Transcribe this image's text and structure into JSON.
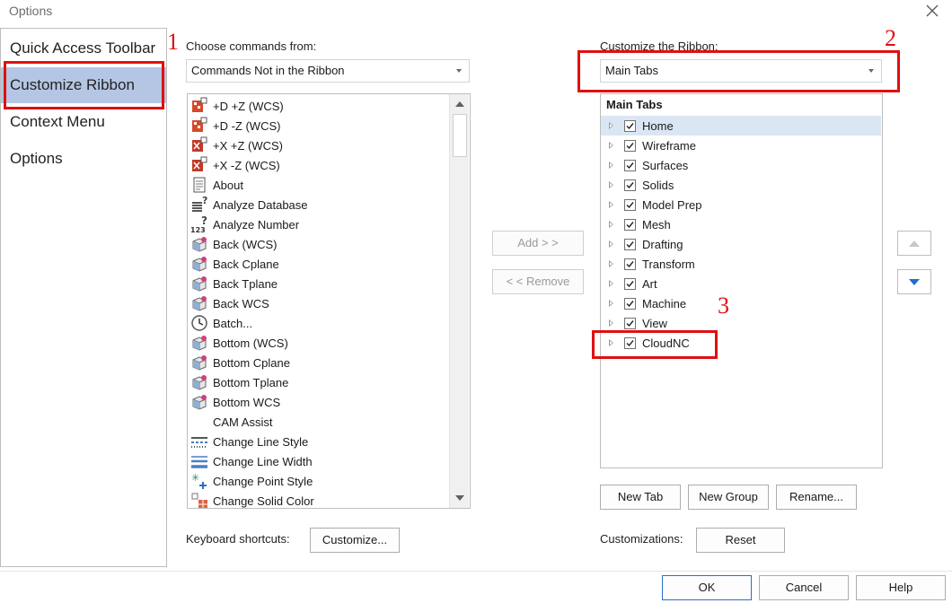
{
  "window": {
    "title": "Options",
    "close_glyph": "✕"
  },
  "nav": {
    "items": [
      {
        "label": "Quick Access Toolbar",
        "selected": false
      },
      {
        "label": "Customize Ribbon",
        "selected": true
      },
      {
        "label": "Context Menu",
        "selected": false
      },
      {
        "label": "Options",
        "selected": false
      }
    ]
  },
  "left_panel": {
    "choose_label": "Choose commands from:",
    "choose_value": "Commands Not in the Ribbon",
    "commands": [
      {
        "label": "+D +Z (WCS)",
        "icon": "view-plus-d-icon"
      },
      {
        "label": "+D -Z (WCS)",
        "icon": "view-plus-d-icon"
      },
      {
        "label": "+X +Z (WCS)",
        "icon": "view-plus-x-icon"
      },
      {
        "label": "+X -Z (WCS)",
        "icon": "view-plus-x-icon"
      },
      {
        "label": "About",
        "icon": "document-icon"
      },
      {
        "label": "Analyze Database",
        "icon": "analyze-database-icon"
      },
      {
        "label": "Analyze Number",
        "icon": "analyze-number-icon"
      },
      {
        "label": "Back (WCS)",
        "icon": "cube-icon"
      },
      {
        "label": "Back Cplane",
        "icon": "cube-icon"
      },
      {
        "label": "Back Tplane",
        "icon": "cube-icon"
      },
      {
        "label": "Back WCS",
        "icon": "cube-icon"
      },
      {
        "label": "Batch...",
        "icon": "clock-icon"
      },
      {
        "label": "Bottom (WCS)",
        "icon": "cube-icon"
      },
      {
        "label": "Bottom Cplane",
        "icon": "cube-icon"
      },
      {
        "label": "Bottom Tplane",
        "icon": "cube-icon"
      },
      {
        "label": "Bottom WCS",
        "icon": "cube-icon"
      },
      {
        "label": "CAM Assist",
        "icon": ""
      },
      {
        "label": "Change Line Style",
        "icon": "line-style-icon"
      },
      {
        "label": "Change Line Width",
        "icon": "line-width-icon"
      },
      {
        "label": "Change Point Style",
        "icon": "point-style-icon"
      },
      {
        "label": "Change Solid Color",
        "icon": "solid-color-icon"
      }
    ],
    "keyboard_label": "Keyboard shortcuts:",
    "customize_btn": "Customize..."
  },
  "middle": {
    "add_btn": "Add > >",
    "remove_btn": "< < Remove"
  },
  "right_panel": {
    "customize_label": "Customize the Ribbon:",
    "customize_value": "Main Tabs",
    "tree_header": "Main Tabs",
    "tabs": [
      {
        "label": "Home",
        "checked": true,
        "selected": true
      },
      {
        "label": "Wireframe",
        "checked": true
      },
      {
        "label": "Surfaces",
        "checked": true
      },
      {
        "label": "Solids",
        "checked": true
      },
      {
        "label": "Model Prep",
        "checked": true
      },
      {
        "label": "Mesh",
        "checked": true
      },
      {
        "label": "Drafting",
        "checked": true
      },
      {
        "label": "Transform",
        "checked": true
      },
      {
        "label": "Art",
        "checked": true
      },
      {
        "label": "Machine",
        "checked": true
      },
      {
        "label": "View",
        "checked": true
      },
      {
        "label": "CloudNC",
        "checked": true
      }
    ],
    "new_tab_btn": "New Tab",
    "new_group_btn": "New Group",
    "rename_btn": "Rename...",
    "customizations_label": "Customizations:",
    "reset_btn": "Reset"
  },
  "annotations": {
    "n1": "1",
    "n2": "2",
    "n3": "3",
    "color": "#e01010"
  },
  "footer": {
    "ok_btn": "OK",
    "cancel_btn": "Cancel",
    "help_btn": "Help"
  }
}
